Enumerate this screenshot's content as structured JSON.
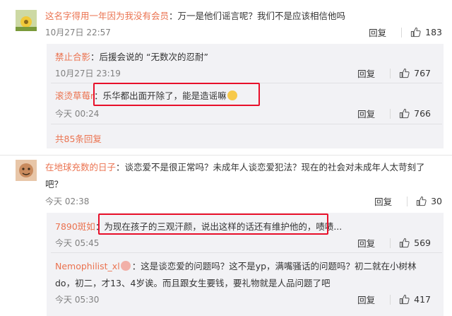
{
  "comments": [
    {
      "user": "这名字得用一年因为我没有会员",
      "text": "：万一是他们谣言呢？我们不是应该相信他吗",
      "time": "10月27日 22:57",
      "reply_label": "回复",
      "likes": "183",
      "replies": [
        {
          "user": "禁止合影",
          "text": "：后援会说的 “无数次的忍耐”",
          "time": "10月27日 23:19",
          "reply_label": "回复",
          "likes": "767"
        },
        {
          "user": "滚烫草莓r",
          "text": "：乐华都出面开除了，能是造谣嘛",
          "time": "今天 00:24",
          "reply_label": "回复",
          "likes": "766"
        }
      ],
      "more_replies": "共85条回复"
    },
    {
      "user": "在地球充数的日子",
      "text_line1": "：谈恋爱不是很正常吗？未成年人谈恋爱犯法？现在的社会对未成年人太苛刻了",
      "text_line2": "吧？",
      "time": "今天 02:38",
      "reply_label": "回复",
      "likes": "30",
      "replies": [
        {
          "user": "7890斑如",
          "text": "：为现在孩子的三观汗颜，说出这样的话还有维护他的，啧啧...",
          "time": "今天 05:45",
          "reply_label": "回复",
          "likes": "569"
        },
        {
          "user": "Nemophilist_xl",
          "text_line1": "：这是谈恋爱的问题吗？这不是yp，满嘴骚话的问题吗？初二就在小树林",
          "text_line2": "do，初二，才13、4岁诶。而且跟女生要钱，要礼物就是人品问题了吧",
          "time": "今天 05:30",
          "reply_label": "回复",
          "likes": "417"
        }
      ]
    }
  ]
}
